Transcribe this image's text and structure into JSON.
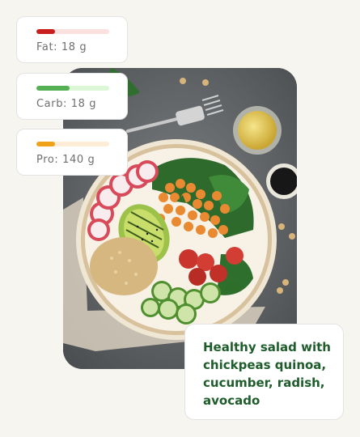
{
  "nutrition": [
    {
      "id": "fat",
      "label": "Fat: 18 g",
      "bar_fraction": 0.25,
      "bar_color": "#c81e1e",
      "track_color": "#fbe0e0"
    },
    {
      "id": "carb",
      "label": "Carb: 18 g",
      "bar_fraction": 0.45,
      "bar_color": "#55b055",
      "track_color": "#dcf7d6"
    },
    {
      "id": "pro",
      "label": "Pro: 140 g",
      "bar_fraction": 0.25,
      "bar_color": "#f0a019",
      "track_color": "#fdecd6"
    }
  ],
  "caption": {
    "text": "Healthy salad with chickpeas quinoa, cucumber, radish, avocado"
  },
  "colors": {
    "caption_text": "#1e5c2b",
    "background": "#f6f5ef"
  },
  "photo": {
    "icon": "salad-bowl-photo"
  }
}
